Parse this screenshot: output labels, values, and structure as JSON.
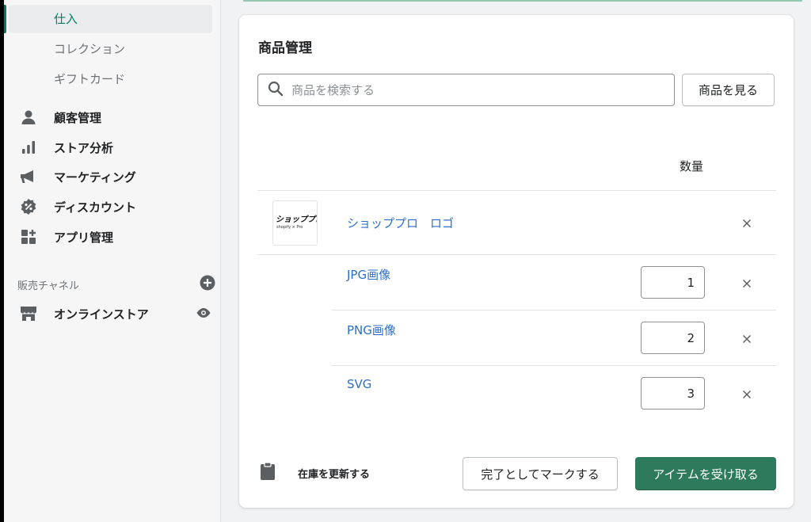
{
  "sidebar": {
    "sub_items": [
      {
        "label": "仕入",
        "active": true
      },
      {
        "label": "コレクション",
        "active": false
      },
      {
        "label": "ギフトカード",
        "active": false
      }
    ],
    "items": [
      {
        "label": "顧客管理",
        "icon": "person-icon"
      },
      {
        "label": "ストア分析",
        "icon": "bar-chart-icon"
      },
      {
        "label": "マーケティング",
        "icon": "megaphone-icon"
      },
      {
        "label": "ディスカウント",
        "icon": "discount-icon"
      },
      {
        "label": "アプリ管理",
        "icon": "apps-icon"
      }
    ],
    "channels_heading": "販売チャネル",
    "channel": {
      "label": "オンラインストア",
      "icon": "store-icon"
    }
  },
  "card": {
    "title": "商品管理",
    "search_placeholder": "商品を検索する",
    "view_button": "商品を見る",
    "quantity_header": "数量",
    "product": {
      "name": "ショッププロ　ロゴ",
      "thumb_title": "ショッププロ",
      "thumb_sub": "shopify × Pro"
    },
    "variants": [
      {
        "name": "JPG画像",
        "quantity": "1"
      },
      {
        "name": "PNG画像",
        "quantity": "2"
      },
      {
        "name": "SVG",
        "quantity": "3"
      }
    ],
    "update_stock_label": "在庫を更新する",
    "mark_complete_button": "完了としてマークする",
    "receive_button": "アイテムを受け取る"
  },
  "colors": {
    "accent": "#008060",
    "primary_button": "#2e7a5c",
    "link": "#2c6ecb"
  }
}
